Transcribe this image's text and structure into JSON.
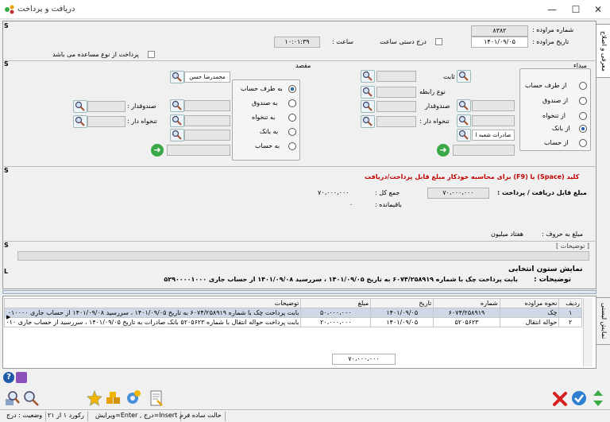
{
  "window": {
    "title": "دریافت و پرداخت"
  },
  "tabs": {
    "top": "معرفی و اصلاح",
    "bottom": "نمایش لیستی"
  },
  "header": {
    "voucher_no_label": "شماره مراوده :",
    "voucher_no": "۸۳۸۲",
    "date_label": "تاریخ مراوده :",
    "date": "۱۴۰۱/۰۹/۰۵",
    "manual_label": "درج دستی ساعت",
    "time_label": "ساعت :",
    "time": "۱۰:۰۱:۳۹",
    "loan_payment_label": "پرداخت از نوع مساعده می باشد",
    "s_marker": "S"
  },
  "source": {
    "title": "مبداء",
    "options": [
      "از طرف حساب",
      "از صندوق",
      "از تنخواه",
      "از بانک",
      "از حساب"
    ],
    "selected": 3,
    "fields": {
      "fixed": "ثابت",
      "relation_type": "نوع رابطه",
      "cashier": "صندوقدار",
      "petty_holder": "تنخواه دار :"
    },
    "branch_value": "صادرات شعبه ا"
  },
  "dest": {
    "title": "مقصد",
    "options": [
      "به طرف حساب",
      "به صندوق",
      "به تنخواه",
      "به بانک",
      "به حساب"
    ],
    "selected": 0,
    "account_value": "محمدرضا حسن",
    "fields": {
      "cashier": "صندوقدار :",
      "petty_holder": "تنخواه دار :"
    }
  },
  "hint": "کلید (Space) یا (F9) برای محاسبه خودکار مبلغ قابل پرداخت/دریافت",
  "amounts": {
    "payable_label": "مبلغ قابل دریافت / پرداخت :",
    "payable": "۷۰،۰۰۰،۰۰۰",
    "total_label": "جمع کل :",
    "total": "۷۰،۰۰۰،۰۰۰",
    "remain_label": "باقیمانده :",
    "remain": "۰",
    "words_label": "مبلغ به حروف :",
    "words": "هفتاد میلیون"
  },
  "desc_panel": {
    "label": "[ توضیحات ]",
    "l_marker": "L"
  },
  "display_col": {
    "title": "نمایش ستون انتخابی",
    "label": "توضیحات :",
    "text": "بابت پرداخت چک با شماره ۶۰۷۴/۲۵۸۹۱۹ به تاریخ ۱۴۰۱/۰۹/۰۵ ، سررسید ۱۴۰۱/۰۹/۰۸ از حساب جاری ۵۲۹۰۰۰۰۱۰۰۰"
  },
  "grid": {
    "columns": [
      "ردیف",
      "نحوه مراوده",
      "شماره",
      "تاریخ",
      "مبلغ",
      "توضیحات"
    ],
    "rows": [
      [
        "۱",
        "چک",
        "۶۰۷۴/۲۵۸۹۱۹",
        "۱۴۰۱/۰۹/۰۵",
        "۵۰،۰۰۰،۰۰۰",
        "بابت پرداخت چک با شماره ۶۰۷۴/۲۵۸۹۱۹ به تاریخ ۱۴۰۱/۰۹/۰۵ ، سررسید ۱۴۰۱/۰۹/۰۸ از حساب جاری ۰۱۰۰۰۰"
      ],
      [
        "۲",
        "حواله انتقال",
        "۵۲۰۵۶۲۳",
        "۱۴۰۱/۰۹/۰۵",
        "۲۰،۰۰۰،۰۰۰",
        "بابت پرداخت حواله انتقال با شماره ۵۲۰۵۶۲۳ بانک صادرات به تاریخ ۱۴۰۱/۰۹/۰۵ ، سررسید از حساب جاری ۰۱۰"
      ]
    ],
    "footer_total": "۷۰،۰۰۰،۰۰۰"
  },
  "status": {
    "mode": "حالت ساده فرم",
    "keys": "Insert=درج , Enter=ویرایش",
    "record": "رکورد ۱ از ۲۱",
    "state": "وضعیت : درج"
  },
  "colors": {
    "accent": "#1e5aa8",
    "hint_red": "#c00000",
    "ok_green": "#39a845"
  }
}
